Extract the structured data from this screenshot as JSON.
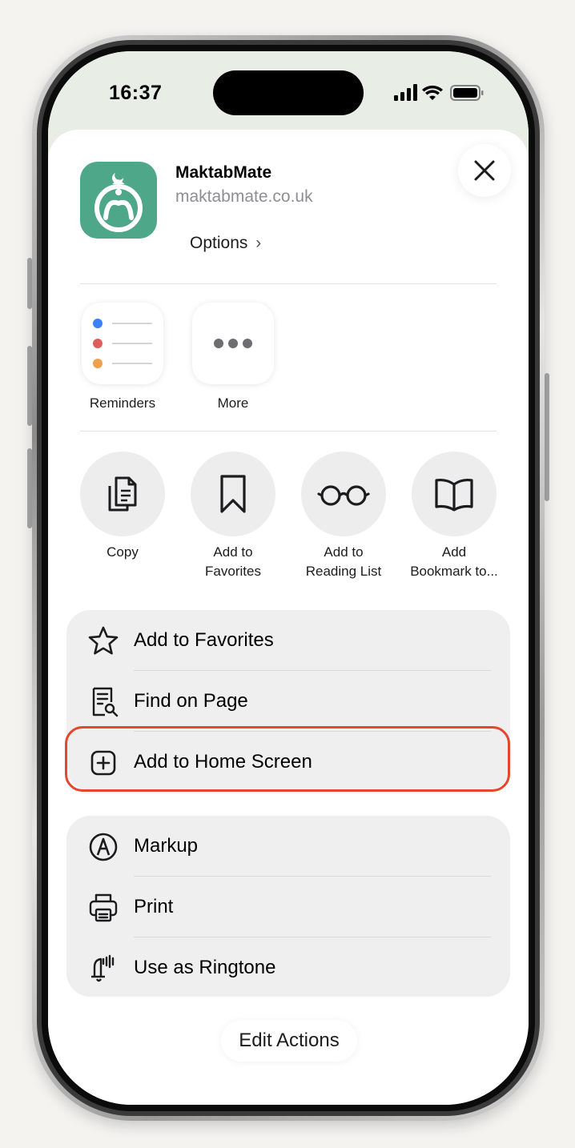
{
  "status_bar": {
    "time": "16:37"
  },
  "share_sheet": {
    "app_name": "MaktabMate",
    "app_url": "maktabmate.co.uk",
    "options_label": "Options",
    "options_chevron": "›",
    "close_icon": "close-icon",
    "apps": [
      {
        "label": "Reminders",
        "icon": "reminders-icon"
      },
      {
        "label": "More",
        "icon": "more-dots-icon"
      }
    ],
    "actions": [
      {
        "label": "Copy",
        "icon": "copy-icon"
      },
      {
        "label": "Add to\nFavorites",
        "icon": "bookmark-icon"
      },
      {
        "label": "Add to\nReading List",
        "icon": "glasses-icon"
      },
      {
        "label": "Add\nBookmark to...",
        "icon": "book-icon"
      }
    ],
    "group1": [
      {
        "label": "Add to Favorites",
        "icon": "star-icon"
      },
      {
        "label": "Find on Page",
        "icon": "find-on-page-icon"
      },
      {
        "label": "Add to Home Screen",
        "icon": "plus-square-icon",
        "highlighted": true
      }
    ],
    "group2": [
      {
        "label": "Markup",
        "icon": "markup-icon"
      },
      {
        "label": "Print",
        "icon": "printer-icon"
      },
      {
        "label": "Use as Ringtone",
        "icon": "bell-icon"
      }
    ],
    "edit_actions_label": "Edit Actions"
  },
  "colors": {
    "app_icon_bg": "#4ea789",
    "highlight_border": "#e4472c",
    "group_bg": "#efefef",
    "reminder_dots": [
      "#3b82f6",
      "#e05d5d",
      "#f0a04b"
    ]
  }
}
